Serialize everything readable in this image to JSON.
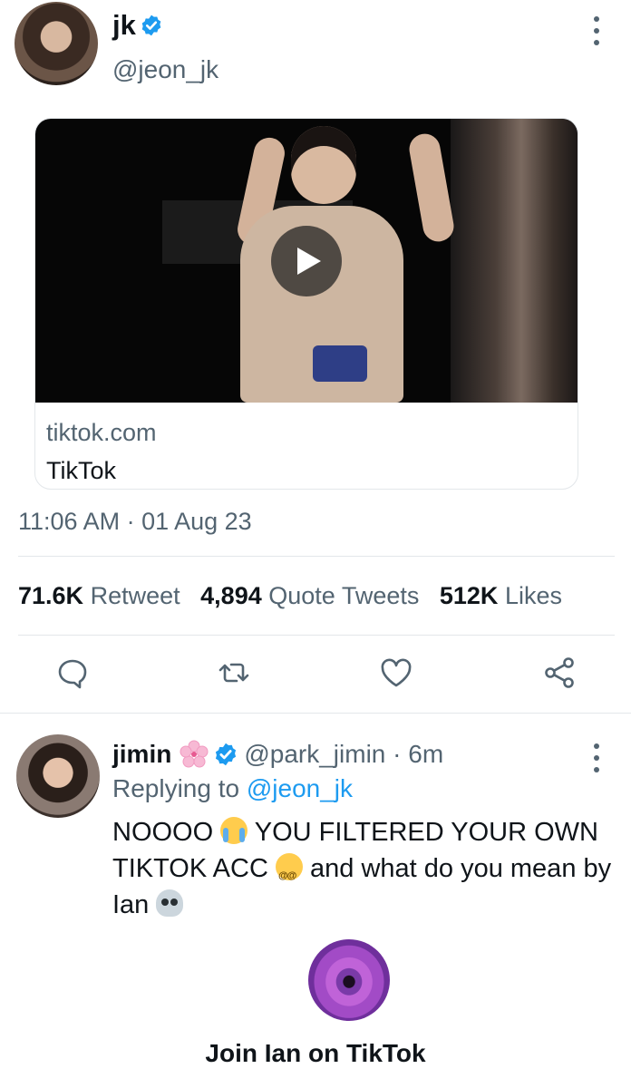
{
  "main_tweet": {
    "display_name": "jk",
    "handle": "@jeon_jk",
    "card": {
      "domain": "tiktok.com",
      "title": "TikTok"
    },
    "timestamp": "11:06 AM · 01 Aug 23",
    "stats": {
      "retweets_count": "71.6K",
      "retweets_label": "Retweet",
      "quotes_count": "4,894",
      "quotes_label": "Quote Tweets",
      "likes_count": "512K",
      "likes_label": "Likes"
    }
  },
  "reply": {
    "display_name": "jimin",
    "handle_time": "@park_jimin · 6m",
    "replying_prefix": "Replying to",
    "replying_handle": "@jeon_jk",
    "text_part1": "NOOOO",
    "text_part2": "YOU FILTERED YOUR OWN TIKTOK ACC",
    "text_part3": "and what do you mean by Ian",
    "embed_label": "Join Ian on TikTok"
  },
  "colors": {
    "accent": "#1d9bf0",
    "secondary_text": "#536471",
    "divider": "#e3e7ea"
  },
  "icons": {
    "verified": "verified-badge-icon",
    "more": "more-vertical-icon",
    "reply": "reply-icon",
    "retweet": "retweet-icon",
    "like": "heart-icon",
    "share": "share-icon",
    "play": "play-icon",
    "flower": "cherry-blossom-emoji",
    "crying": "loudly-crying-emoji",
    "dizzy": "dizzy-face-emoji",
    "skull": "skull-emoji"
  }
}
